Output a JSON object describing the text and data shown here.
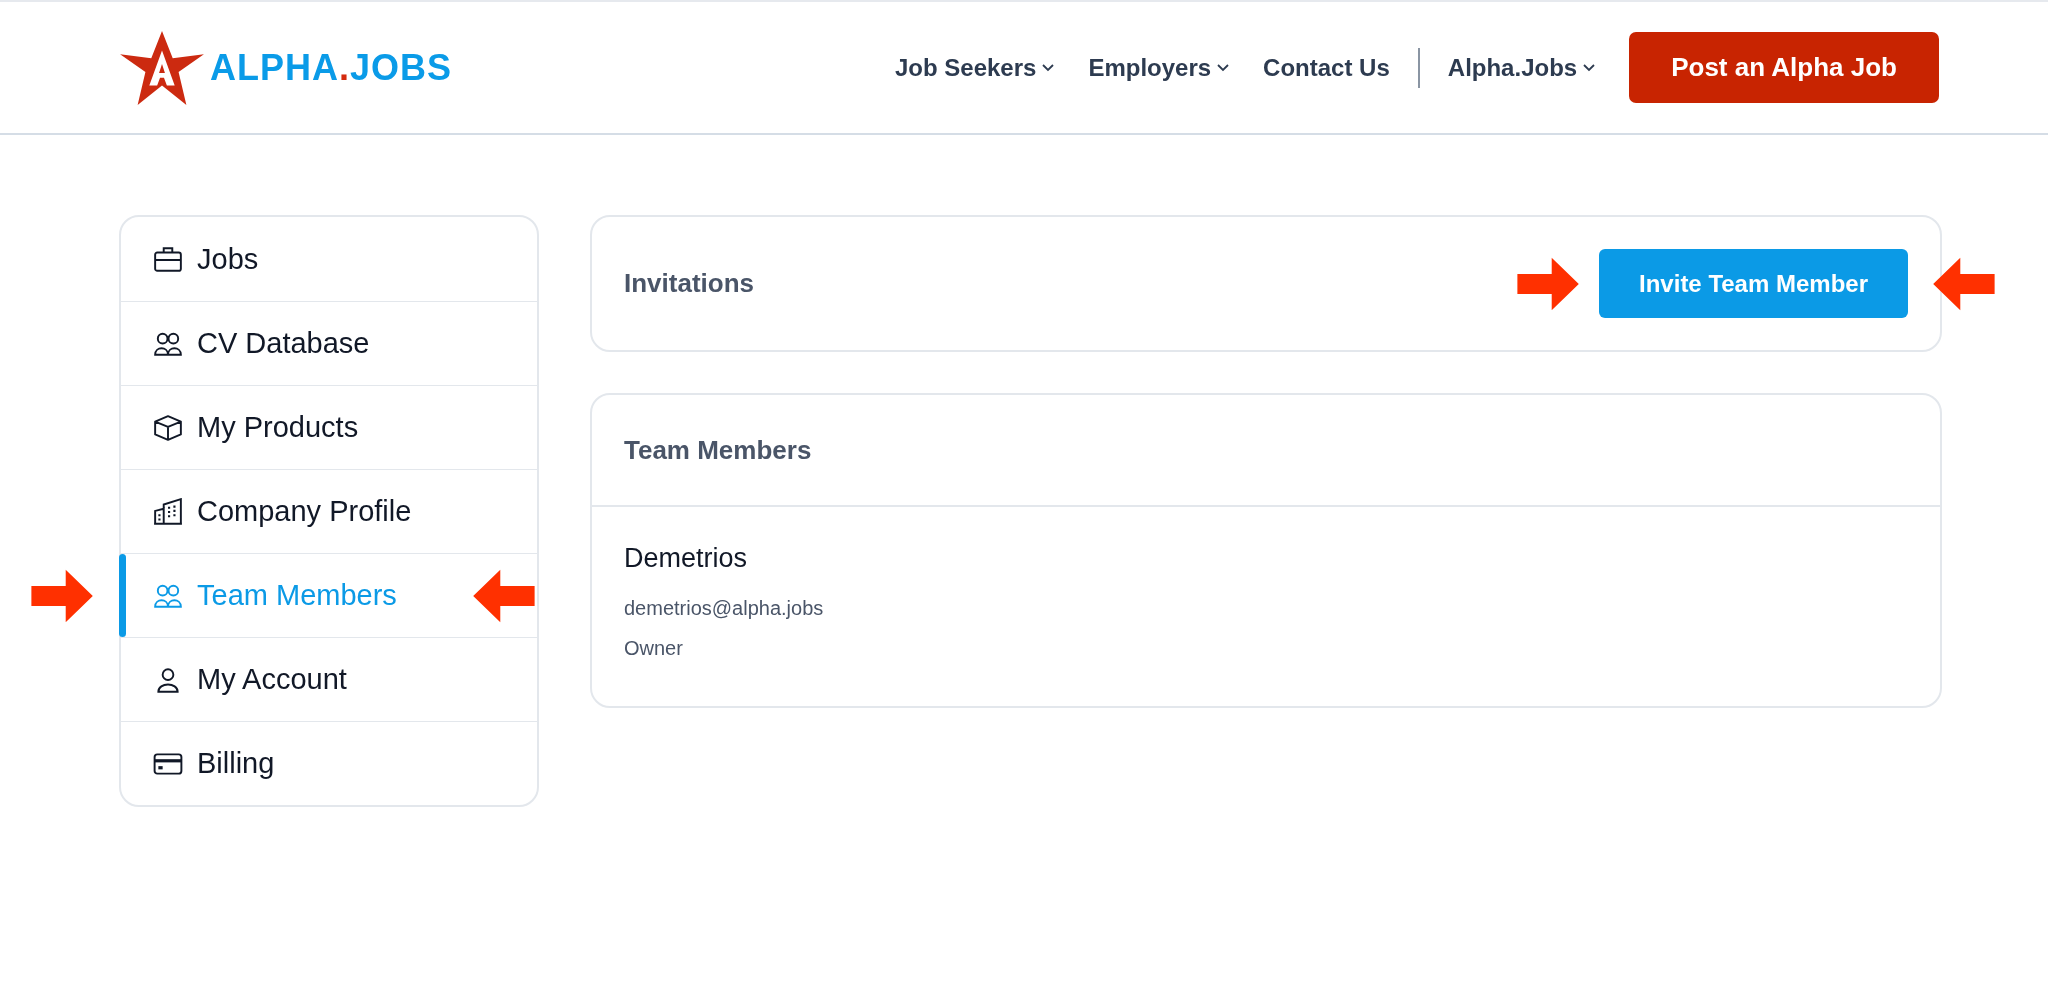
{
  "logo": {
    "parts": [
      {
        "text": "ALPHA",
        "color": "#0a9be8"
      },
      {
        "text": ".",
        "color": "#d42a0e"
      },
      {
        "text": "JOBS",
        "color": "#0a9be8"
      }
    ]
  },
  "nav": {
    "items": [
      {
        "label": "Job Seekers",
        "has_menu": true,
        "divider_before": false
      },
      {
        "label": "Employers",
        "has_menu": true,
        "divider_before": false
      },
      {
        "label": "Contact Us",
        "has_menu": false,
        "divider_before": false
      },
      {
        "label": "Alpha.Jobs",
        "has_menu": true,
        "divider_before": true
      }
    ],
    "cta": "Post an Alpha Job"
  },
  "sidebar": {
    "items": [
      {
        "label": "Jobs",
        "kind": "briefcase",
        "selected": false,
        "pointed": false
      },
      {
        "label": "CV Database",
        "kind": "people",
        "selected": false,
        "pointed": false
      },
      {
        "label": "My Products",
        "kind": "box",
        "selected": false,
        "pointed": false
      },
      {
        "label": "Company Profile",
        "kind": "building",
        "selected": false,
        "pointed": false
      },
      {
        "label": "Team Members",
        "kind": "people",
        "selected": true,
        "pointed": true
      },
      {
        "label": "My Account",
        "kind": "person",
        "selected": false,
        "pointed": false
      },
      {
        "label": "Billing",
        "kind": "card",
        "selected": false,
        "pointed": false
      }
    ]
  },
  "invitations": {
    "title": "Invitations",
    "button": "Invite Team Member",
    "button_pointed": true
  },
  "team": {
    "title": "Team Members",
    "members": [
      {
        "name": "Demetrios",
        "email": "demetrios@alpha.jobs",
        "role": "Owner"
      }
    ]
  }
}
